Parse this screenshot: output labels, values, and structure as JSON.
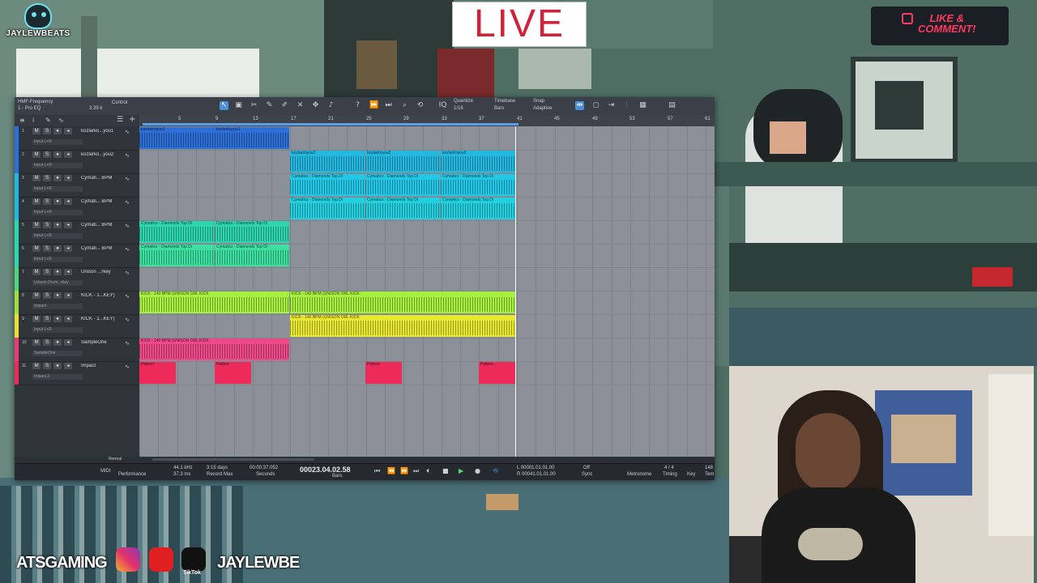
{
  "overlay": {
    "logo_text": "JAYLEWBEATS",
    "live_label": "LIVE",
    "like_line1": "LIKE &",
    "like_line2": "COMMENT!",
    "social_left_text": "ATSGAMING",
    "social_right_text": "JAYLEWBE",
    "tiktok_label": "TikTok"
  },
  "daw": {
    "track_header": "HMF-Frequency",
    "preset": "1 - Pro EQ",
    "control_label": "Control",
    "cpu": "3.39 k",
    "quantize_label": "Quantize",
    "quantize_value": "1/16",
    "timebase_label": "Timebase",
    "timebase_value": "Bars",
    "snap_label": "Snap",
    "snap_value": "Adaptive",
    "ruler_marks": [
      "5",
      "9",
      "13",
      "17",
      "21",
      "25",
      "29",
      "33",
      "37",
      "41",
      "45",
      "49",
      "53",
      "57",
      "61"
    ],
    "tracks": [
      {
        "num": "1",
        "name": "kozlarko...you1",
        "input": "Input L+R",
        "color": "#2d6fd6"
      },
      {
        "num": "2",
        "name": "kozlarko...you2",
        "input": "Input L+R",
        "color": "#2d6fd6"
      },
      {
        "num": "3",
        "name": "Cymati... BPM",
        "input": "Input L+R",
        "color": "#22b8e0"
      },
      {
        "num": "4",
        "name": "Cymati... BPM",
        "input": "Input L+R",
        "color": "#22b8e0"
      },
      {
        "num": "5",
        "name": "Cymati... BPM",
        "input": "Input L+R",
        "color": "#2ed6b0"
      },
      {
        "num": "6",
        "name": "Cymati... BPM",
        "input": "Input L+R",
        "color": "#2ed6b0"
      },
      {
        "num": "7",
        "name": "Unison ...rkey",
        "input": "Unison Drum...rkey",
        "color": "#4ed67a"
      },
      {
        "num": "8",
        "name": "KICK - 1...KEY)",
        "input": "Impact",
        "color": "#9ee040"
      },
      {
        "num": "9",
        "name": "KICK - 1...KEY)",
        "input": "Input L+R",
        "color": "#e8e030"
      },
      {
        "num": "10",
        "name": "SampleOne",
        "input": "SampleOne",
        "color": "#ee3a7a"
      },
      {
        "num": "11",
        "name": "Impact",
        "input": "Impact 2",
        "color": "#ee2a5a"
      }
    ],
    "clip_labels": {
      "t1": "kozlarkoyou1",
      "t2": "kozlarkoyou2",
      "cym": "Cymatics - Diamonds Top Di",
      "kick": "KICK - 140 BPM (UNISON ORL KICK",
      "pattern": "Pattern"
    },
    "transport": {
      "sample_rate": "44.1 kHz",
      "latency": "37.3 ms",
      "record_max_value": "3:15 days",
      "record_max_label": "Record Max",
      "seconds_value": "00:00:37.052",
      "seconds_label": "Seconds",
      "bars_value": "00023.04.02.58",
      "bars_label": "Bars",
      "loop_l": "L 00001.01.01.00",
      "loop_r": "R 00041.01.01.00",
      "sync_label": "Sync",
      "sync_value": "Off",
      "metronome_label": "Metronome",
      "timing_label": "Timing",
      "timing_value": "4 / 4",
      "key_label": "Key",
      "tempo_label": "Tem",
      "tempo_value": "148",
      "midi_label": "MIDI",
      "performance_label": "Performance",
      "normal_label": "Normal"
    }
  }
}
